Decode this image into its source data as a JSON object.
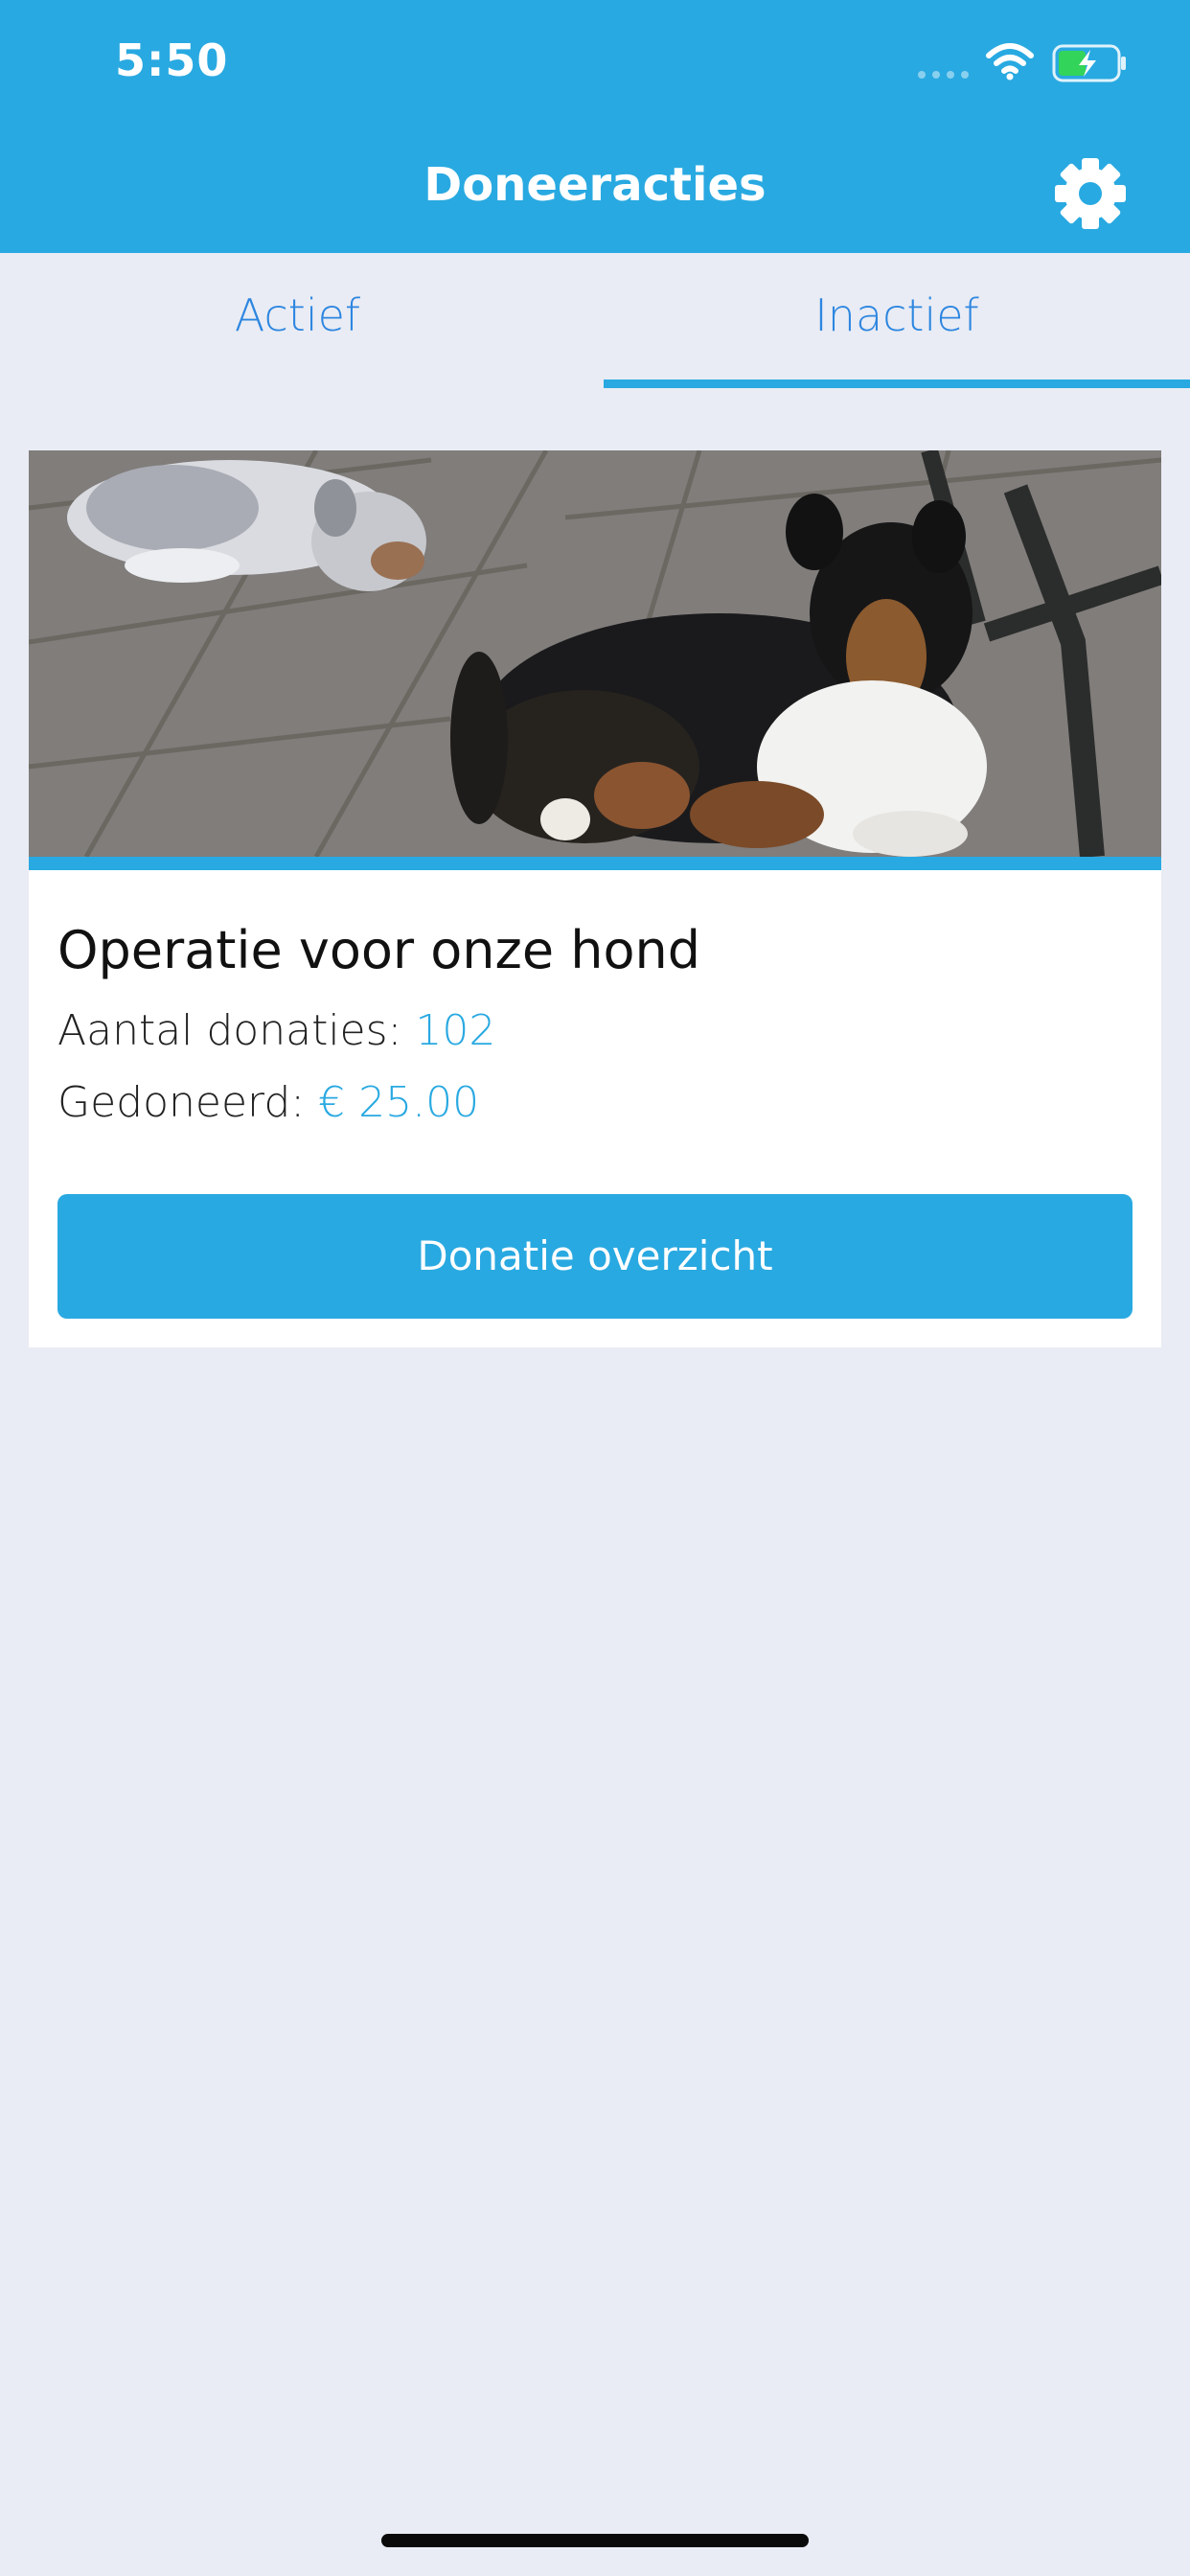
{
  "status_bar": {
    "time": "5:50"
  },
  "header": {
    "title": "Doneeracties",
    "settings_icon": "gear-icon"
  },
  "tabs": [
    {
      "label": "Actief",
      "selected": false
    },
    {
      "label": "Inactief",
      "selected": true
    }
  ],
  "campaign": {
    "title": "Operatie voor onze hond",
    "donations_label": "Aantal donaties:",
    "donations_count": "102",
    "donated_label": "Gedoneerd:",
    "donated_amount": "€ 25.00",
    "button_label": "Donatie overzicht"
  },
  "colors": {
    "accent": "#29a9e1",
    "tab_text": "#2d86e0",
    "background": "#e9ecf4"
  }
}
